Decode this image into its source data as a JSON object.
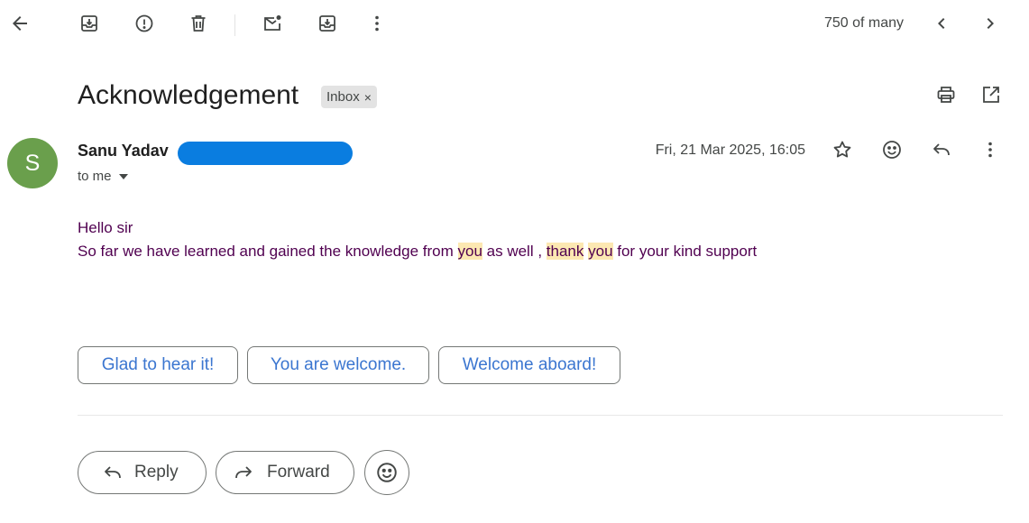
{
  "toolbar": {
    "icons": [
      "back-arrow-icon",
      "archive-icon",
      "report-spam-icon",
      "delete-icon",
      "mark-unread-icon",
      "move-to-icon",
      "more-vert-icon"
    ],
    "page_count": "750 of many",
    "nav_icons": [
      "chevron-left-icon",
      "chevron-right-icon"
    ]
  },
  "message": {
    "subject": "Acknowledgement",
    "label": "Inbox",
    "label_remove": "×",
    "header_actions": [
      "print-icon",
      "open-in-new-window-icon"
    ],
    "sender": {
      "initial": "S",
      "name": "Sanu Yadav",
      "avatar_color": "#6a9f4c",
      "recipient": "to me"
    },
    "date": "Fri, 21 Mar 2025, 16:05",
    "actions": [
      "star-icon",
      "emoji-react-icon",
      "reply-icon",
      "more-vert-icon"
    ],
    "body": {
      "line1": "Hello sir",
      "line2_parts": {
        "p1": "So far we have learned and gained the knowledge from ",
        "hl1": "you",
        "p2": " as well , ",
        "hl2": "thank",
        "p3": " ",
        "hl3": "you",
        "p4": " for your kind support"
      },
      "text_color": "#500050",
      "highlight_color": "#fce8b2"
    }
  },
  "smart_replies": [
    "Glad to hear it!",
    "You are welcome.",
    "Welcome aboard!"
  ],
  "footer": {
    "reply_label": "Reply",
    "forward_label": "Forward"
  },
  "colors": {
    "accent_blue": "#3b76d0",
    "redaction": "#0a7de0"
  }
}
